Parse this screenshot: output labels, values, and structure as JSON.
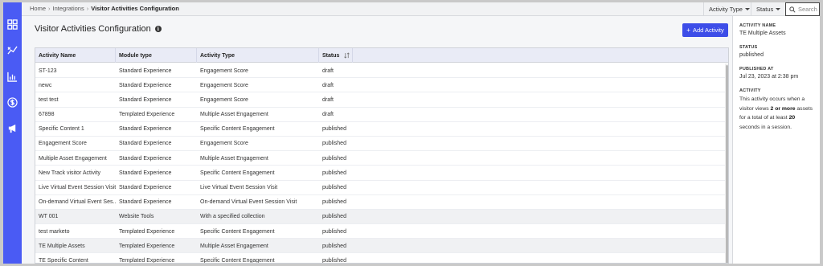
{
  "breadcrumb": {
    "home": "Home",
    "integrations": "Integrations",
    "current": "Visitor Activities Configuration"
  },
  "filters": {
    "activity_type": "Activity Type",
    "status": "Status"
  },
  "search": {
    "placeholder": "Search"
  },
  "page": {
    "title": "Visitor Activities Configuration",
    "add_button": "Add Activity"
  },
  "table": {
    "columns": [
      "Activity Name",
      "Module type",
      "Activity Type",
      "Status"
    ],
    "rows": [
      [
        "ST-123",
        "Standard Experience",
        "Engagement Score",
        "draft"
      ],
      [
        "newc",
        "Standard Experience",
        "Engagement Score",
        "draft"
      ],
      [
        "test test",
        "Standard Experience",
        "Engagement Score",
        "draft"
      ],
      [
        "67898",
        "Templated Experience",
        "Multiple Asset Engagement",
        "draft"
      ],
      [
        "Specific Content 1",
        "Standard Experience",
        "Specific Content Engagement",
        "published"
      ],
      [
        "Engagement Score",
        "Standard Experience",
        "Engagement Score",
        "published"
      ],
      [
        "Multiple Asset Engagement",
        "Standard Experience",
        "Multiple Asset Engagement",
        "published"
      ],
      [
        "New Track visitor Activity",
        "Standard Experience",
        "Specific Content Engagement",
        "published"
      ],
      [
        "Live Virtual Event Session Visit",
        "Standard Experience",
        "Live Virtual Event Session Visit",
        "published"
      ],
      [
        "On-demand Virtual Event Ses...",
        "Standard Experience",
        "On-demand Virtual Event Session Visit",
        "published"
      ],
      [
        "WT 001",
        "Website Tools",
        "With a specified collection",
        "published"
      ],
      [
        "test marketo",
        "Templated Experience",
        "Specific Content Engagement",
        "published"
      ],
      [
        "TE Multiple Assets",
        "Templated Experience",
        "Multiple Asset Engagement",
        "published"
      ],
      [
        "TE Specific Content",
        "Templated Experience",
        "Specific Content Engagement",
        "published"
      ]
    ]
  },
  "detail": {
    "name_label": "ACTIVITY NAME",
    "name_value": "TE Multiple Assets",
    "status_label": "STATUS",
    "status_value": "published",
    "published_label": "PUBLISHED AT",
    "published_value": "Jul 23, 2023 at 2:38 pm",
    "activity_label": "ACTIVITY",
    "desc_1": "This activity occurs when a visitor views ",
    "desc_bold_1": "2 or more",
    "desc_2": " assets for a total of at least ",
    "desc_bold_2": "20",
    "desc_3": " seconds in a session."
  },
  "sidebar": {
    "icons": [
      "dashboard-icon",
      "analytics-chart-icon",
      "bar-chart-icon",
      "dollar-icon",
      "megaphone-icon"
    ]
  },
  "colors": {
    "sidebar": "#4a5bf4",
    "primary_button": "#3d4de8",
    "table_header": "#e9ebf6"
  }
}
